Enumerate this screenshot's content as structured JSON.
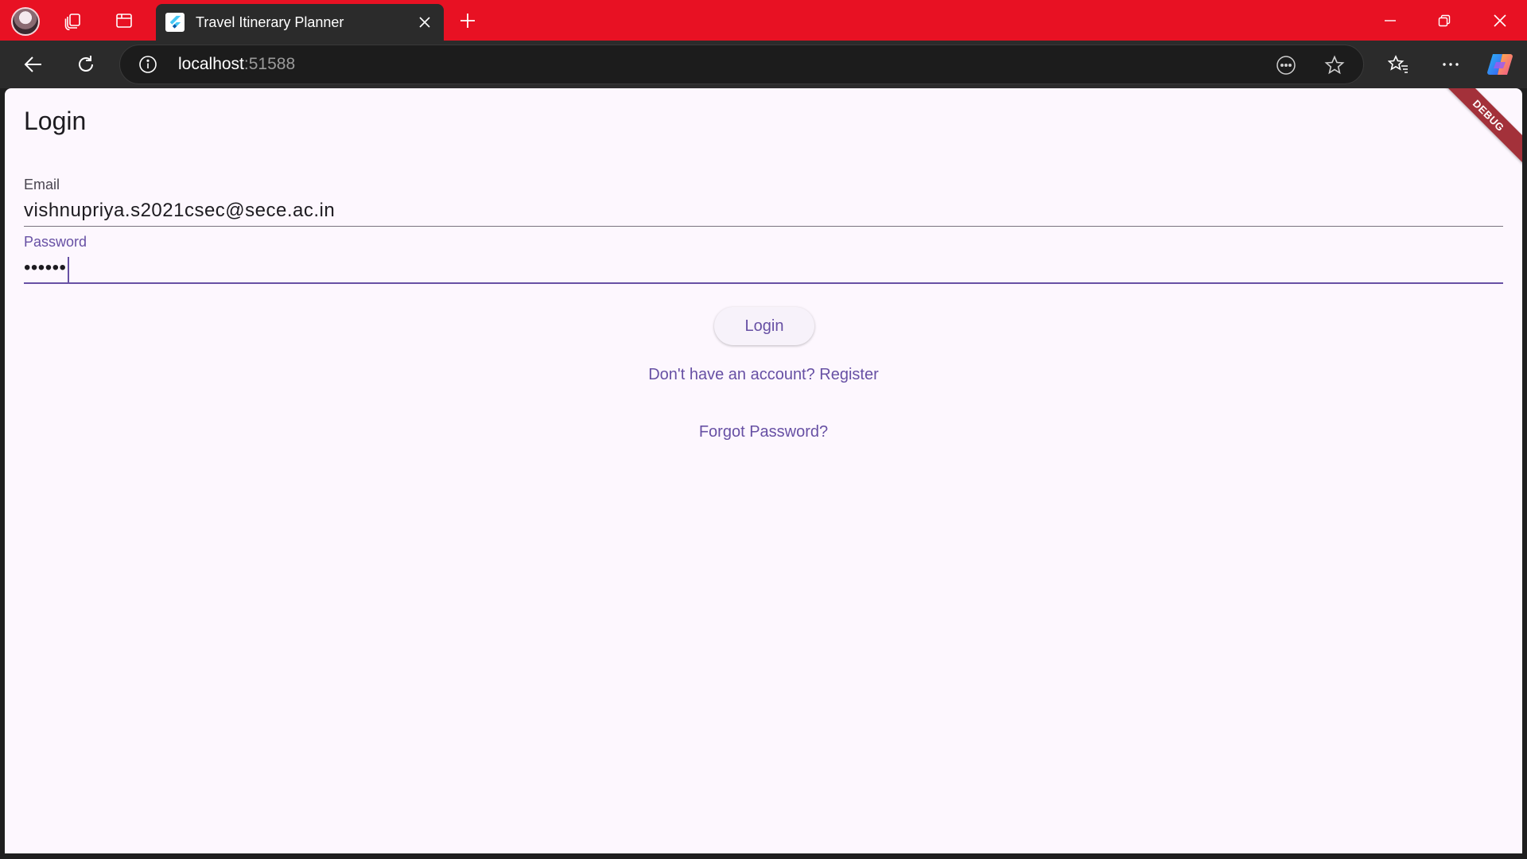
{
  "browser": {
    "tab": {
      "title": "Travel Itinerary Planner"
    },
    "address": {
      "host": "localhost",
      "port": ":51588"
    }
  },
  "page": {
    "title": "Login",
    "debug_banner": "DEBUG",
    "email": {
      "label": "Email",
      "value": "vishnupriya.s2021csec@sece.ac.in"
    },
    "password": {
      "label": "Password",
      "value": "••••••"
    },
    "login_button": "Login",
    "register_link": "Don't have an account? Register",
    "forgot_link": "Forgot Password?"
  },
  "colors": {
    "titlebar": "#e81123",
    "page_background": "#fdf7fe",
    "accent": "#6750a4"
  }
}
